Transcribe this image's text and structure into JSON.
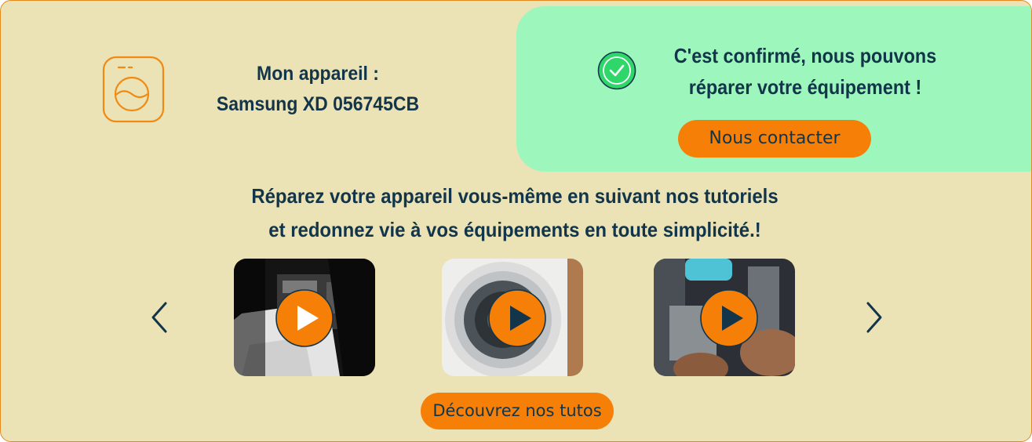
{
  "device": {
    "icon": "washing-machine-icon",
    "label": "Mon appareil :",
    "model": "Samsung XD 056745CB"
  },
  "confirmation": {
    "icon": "check-circle-icon",
    "line1": "C'est confirmé, nous pouvons",
    "line2": "réparer votre équipement !",
    "button_label": "Nous contacter"
  },
  "tutorials": {
    "headline_line1": "Réparez votre appareil vous-même en suivant nos tutoriels",
    "headline_line2": "et redonnez vie à vos équipements en toute simplicité.!",
    "prev_icon": "chevron-left-icon",
    "next_icon": "chevron-right-icon",
    "videos": [
      {
        "thumbnail": "dark-room-washing-machine",
        "icon": "play-icon"
      },
      {
        "thumbnail": "washing-machine-door",
        "icon": "play-icon"
      },
      {
        "thumbnail": "hands-repairing-appliance",
        "icon": "play-icon"
      }
    ],
    "button_label": "Découvrez nos tutos"
  },
  "colors": {
    "background": "#ebe2b6",
    "border": "#e58a1f",
    "accent": "#f57f07",
    "confirm_panel": "#9df7bd",
    "text": "#12354a"
  }
}
